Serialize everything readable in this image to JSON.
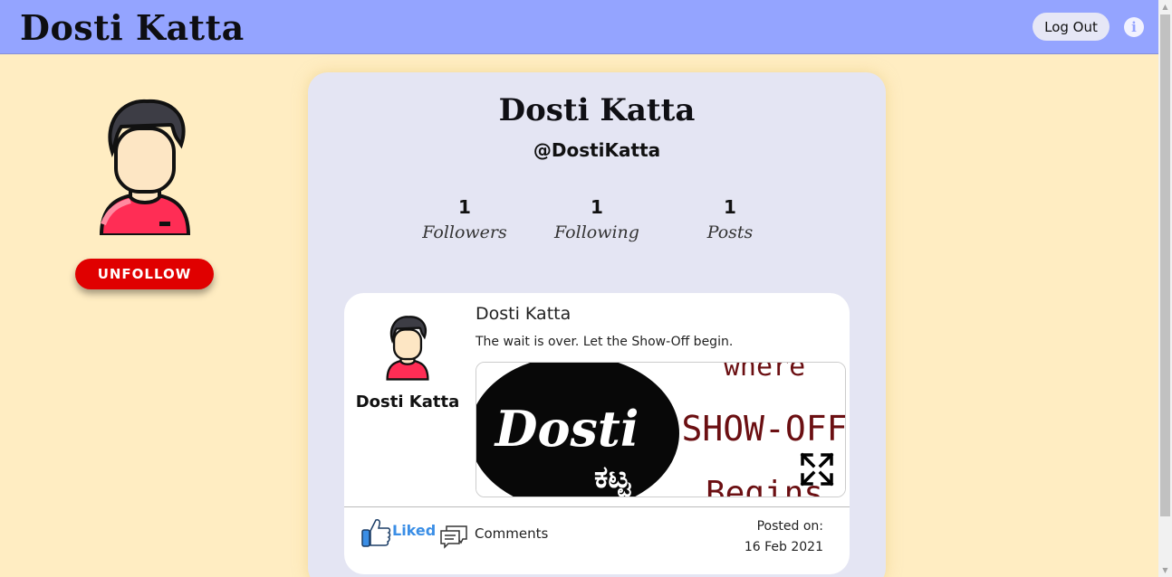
{
  "header": {
    "brand": "Dosti Katta",
    "logout_label": "Log Out",
    "info_icon": "info-icon",
    "bg_color": "#94a4ff"
  },
  "sidebar": {
    "avatar_icon": "user-avatar-icon",
    "unfollow_label": "UNFOLLOW",
    "unfollow_color": "#e00000"
  },
  "profile": {
    "name": "Dosti Katta",
    "handle": "@DostiKatta",
    "stats": [
      {
        "value": "1",
        "label": "Followers"
      },
      {
        "value": "1",
        "label": "Following"
      },
      {
        "value": "1",
        "label": "Posts"
      }
    ]
  },
  "post": {
    "author_side": "Dosti Katta",
    "author": "Dosti Katta",
    "text": "The wait is over. Let the Show-Off begin.",
    "image": {
      "logo_text": "Dosti",
      "logo_script": "ಕಟ್ಟ",
      "caption_lines": [
        "where",
        "SHOW-OFF",
        "Begins"
      ]
    },
    "liked_label": "Liked",
    "comments_label": "Comments",
    "posted_label": "Posted on:",
    "posted_date": "16 Feb 2021",
    "like_color": "#3a8ee6"
  },
  "page_bg": "#ffedc2",
  "card_bg": "#e4e5f3"
}
